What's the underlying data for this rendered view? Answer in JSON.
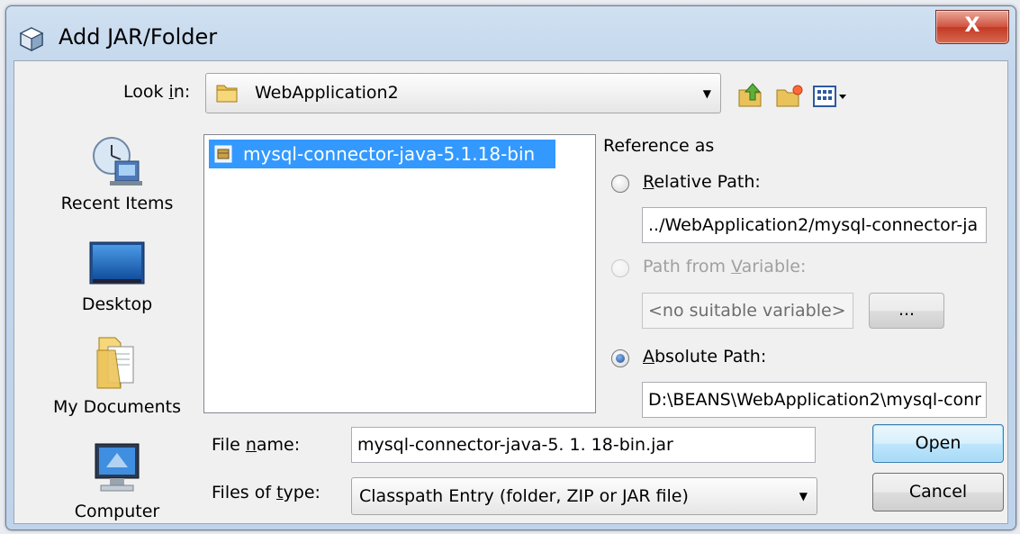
{
  "window": {
    "title": "Add JAR/Folder",
    "close_label": "X"
  },
  "look_in": {
    "label": "Look in:",
    "mnemonic": "i",
    "value": "WebApplication2"
  },
  "toolbar": {
    "up_icon": "up-folder-icon",
    "new_folder_icon": "new-folder-icon",
    "view_icon": "view-menu-icon"
  },
  "places": [
    {
      "label": "Recent Items",
      "icon": "recent-items-icon"
    },
    {
      "label": "Desktop",
      "icon": "desktop-icon"
    },
    {
      "label": "My Documents",
      "icon": "my-documents-icon"
    },
    {
      "label": "Computer",
      "icon": "computer-icon"
    }
  ],
  "files": [
    {
      "name": "mysql-connector-java-5.1.18-bin",
      "selected": true
    }
  ],
  "reference": {
    "heading": "Reference as",
    "relative": {
      "label": "Relative Path:",
      "value": "../WebApplication2/mysql-connector-ja",
      "checked": false
    },
    "variable": {
      "label": "Path from Variable:",
      "placeholder": "<no suitable variable>",
      "browse_label": "...",
      "enabled": false
    },
    "absolute": {
      "label": "Absolute Path:",
      "value": "D:\\BEANS\\WebApplication2\\mysql-conr",
      "checked": true
    }
  },
  "file_name": {
    "label": "File name:",
    "value": "mysql-connector-java-5. 1. 18-bin.jar"
  },
  "file_type": {
    "label": "Files of type:",
    "value": "Classpath Entry (folder, ZIP or JAR file)"
  },
  "buttons": {
    "open": "Open",
    "cancel": "Cancel"
  },
  "colors": {
    "selection": "#3399ff",
    "title_bar": "#c4d7ec",
    "close_button": "#c23a24"
  }
}
